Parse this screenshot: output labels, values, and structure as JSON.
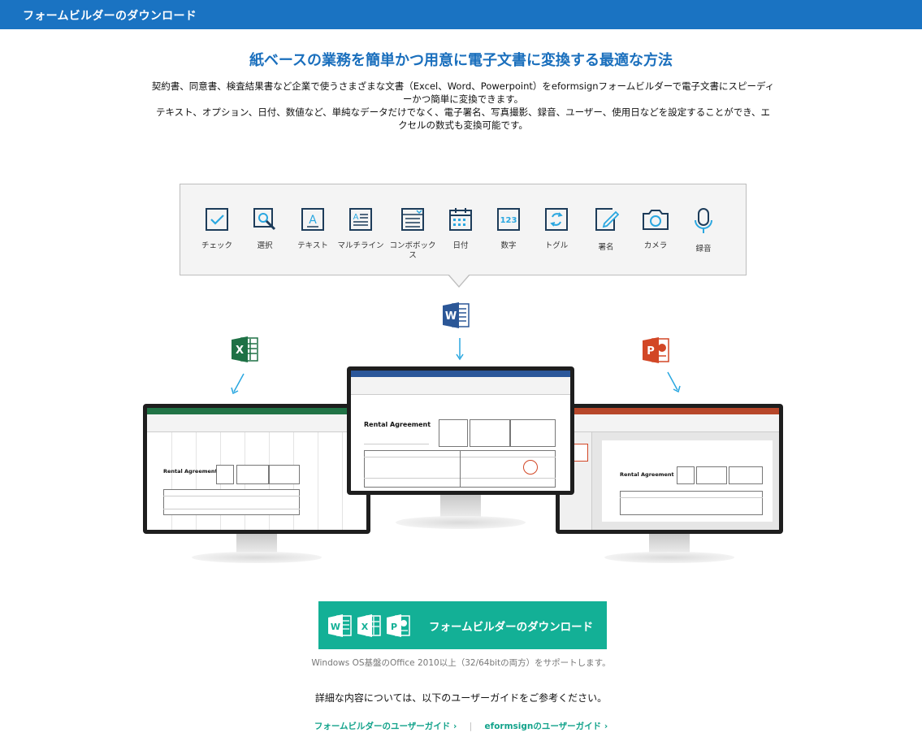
{
  "titlebar": {
    "title": "フォームビルダーのダウンロード"
  },
  "headline": "紙ベースの業務を簡単かつ用意に電子文書に変換する最適な方法",
  "description": {
    "line1": "契約書、同意書、検査結果書など企業で使うさまざまな文書（Excel、Word、Powerpoint）をeformsignフォームビルダーで電子文書にスピーディ",
    "line2": "ーかつ簡単に変換できます。",
    "line3": "テキスト、オプション、日付、数値など、単純なデータだけでなく、電子署名、写真撮影、録音、ユーザー、使用日などを設定することができ、エ",
    "line4": "クセルの数式も変換可能です。"
  },
  "tools": [
    {
      "label": "チェック",
      "icon": "checkbox-icon"
    },
    {
      "label": "選択",
      "icon": "select-cursor-icon"
    },
    {
      "label": "テキスト",
      "icon": "text-icon"
    },
    {
      "label": "マルチライン",
      "icon": "multiline-icon"
    },
    {
      "label": "コンボボックス",
      "icon": "combobox-icon"
    },
    {
      "label": "日付",
      "icon": "calendar-icon"
    },
    {
      "label": "数字",
      "icon": "number-icon"
    },
    {
      "label": "トグル",
      "icon": "toggle-icon"
    },
    {
      "label": "署名",
      "icon": "signature-icon"
    },
    {
      "label": "カメラ",
      "icon": "camera-icon"
    },
    {
      "label": "録音",
      "icon": "microphone-icon"
    }
  ],
  "apps": {
    "word": "W",
    "excel": "X",
    "powerpoint": "P"
  },
  "document": {
    "title": "Rental Agreement"
  },
  "download_button": {
    "label": "フォームビルダーのダウンロード"
  },
  "support_note": "Windows OS基盤のOffice 2010以上（32/64bitの両方）をサポートします。",
  "detail_note": "詳細な内容については、以下のユーザーガイドをご参考ください。",
  "links": {
    "form_builder_guide": "フォームビルダーのユーザーガイド ›",
    "separator": "|",
    "eformsign_guide": "eformsignのユーザーガイド ›"
  },
  "colors": {
    "header_blue": "#1a73c2",
    "headline_blue": "#1a6fbd",
    "accent_teal": "#13b096",
    "word_blue": "#2b5797",
    "excel_green": "#1e7145",
    "ppt_orange": "#d24726",
    "arrow_blue": "#2aa7e0"
  }
}
